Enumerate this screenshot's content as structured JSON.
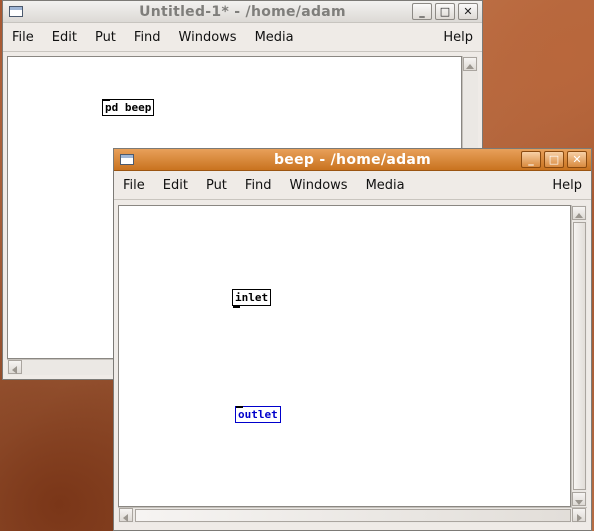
{
  "windows": [
    {
      "title": "Untitled-1* - /home/adam",
      "state": "inactive",
      "menu": [
        "File",
        "Edit",
        "Put",
        "Find",
        "Windows",
        "Media"
      ],
      "help": "Help",
      "objects": [
        {
          "text": "pd beep",
          "selected": false
        }
      ]
    },
    {
      "title": "beep  - /home/adam",
      "state": "active",
      "menu": [
        "File",
        "Edit",
        "Put",
        "Find",
        "Windows",
        "Media"
      ],
      "help": "Help",
      "objects": [
        {
          "text": "inlet",
          "selected": false
        },
        {
          "text": "outlet",
          "selected": true
        }
      ]
    }
  ],
  "title_buttons": {
    "minimize": "_",
    "maximize": "□",
    "close": "✕"
  },
  "colors": {
    "active_title": "#d9862f",
    "selection": "#0000cc",
    "canvas": "#ffffff"
  }
}
